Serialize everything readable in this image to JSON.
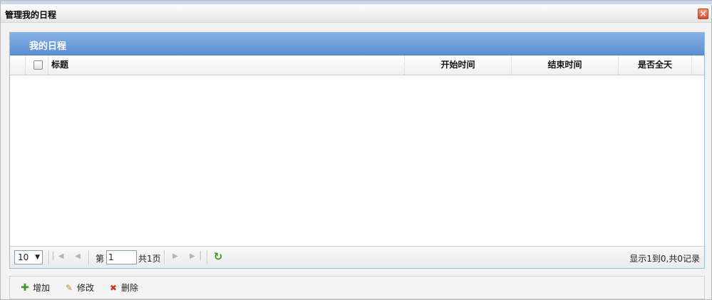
{
  "dialog": {
    "title": "管理我的日程",
    "close_label": "×"
  },
  "panel": {
    "title": "我的日程"
  },
  "grid": {
    "columns": [
      "标题",
      "开始时间",
      "结束时间",
      "是否全天"
    ],
    "rows": []
  },
  "pager": {
    "page_size": "10",
    "page_prefix": "第",
    "page_value": "1",
    "page_suffix": "共1页",
    "info": "显示1到0,共0记录"
  },
  "toolbar": {
    "add_label": "增加",
    "edit_label": "修改",
    "delete_label": "删除"
  },
  "colors": {
    "panel_header": "#5b8fd3",
    "panel_border": "#99bbe8",
    "refresh": "#3e9a26"
  },
  "icons": [
    "close-icon",
    "first-page-icon",
    "prev-page-icon",
    "next-page-icon",
    "last-page-icon",
    "refresh-icon",
    "add-icon",
    "edit-icon",
    "delete-icon"
  ]
}
